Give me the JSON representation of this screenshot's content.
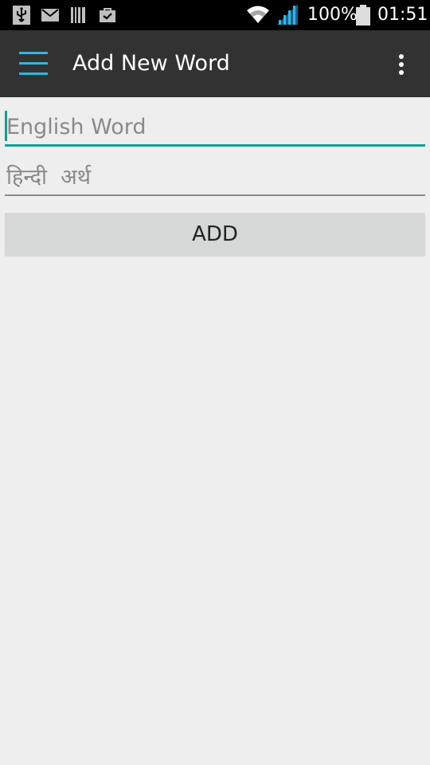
{
  "status_bar": {
    "battery_text": "100%",
    "time": "01:51",
    "icons": [
      "usb-icon",
      "mail-icon",
      "barcode-icon",
      "bag-icon",
      "wifi-icon",
      "signal-icon",
      "battery-icon"
    ]
  },
  "toolbar": {
    "title": "Add New Word",
    "menu_icon": "hamburger-menu-icon",
    "overflow_icon": "overflow-menu-icon"
  },
  "form": {
    "english_placeholder": "English Word",
    "english_value": "",
    "hindi_placeholder": "हिन्दी  अर्थ",
    "hindi_value": "",
    "add_label": "ADD"
  },
  "colors": {
    "status_bar": "#000000",
    "action_bar": "#323232",
    "accent_menu": "#33b5e5",
    "focus_teal": "#14a08e",
    "background": "#eeeeee",
    "button": "#d6d7d7"
  }
}
